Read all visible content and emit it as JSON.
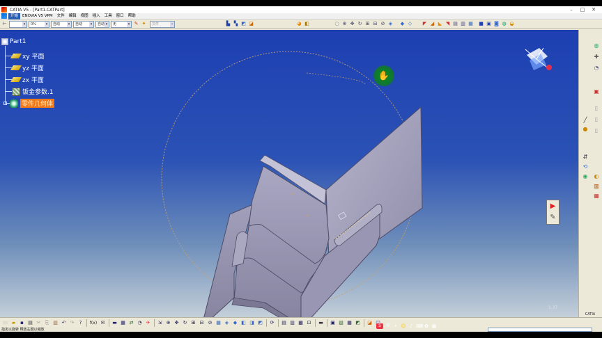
{
  "window": {
    "title": "CATIA V5 - [Part1.CATPart]",
    "buttons": {
      "minimize": "–",
      "maximize": "□",
      "close": "✕"
    }
  },
  "menu": {
    "items": [
      "开始",
      "ENOVIA V5 VPM",
      "文件",
      "编辑",
      "视图",
      "插入",
      "工具",
      "窗口",
      "帮助"
    ],
    "active_index": 0
  },
  "toolbar_top": {
    "combos": [
      "",
      "0%",
      "自动",
      "自动",
      "自动",
      "无"
    ],
    "combo_filter": "文件"
  },
  "tree": {
    "root": "Part1",
    "nodes": [
      {
        "label": "xy 平面",
        "icon": "plane-icon"
      },
      {
        "label": "yz 平面",
        "icon": "plane-icon"
      },
      {
        "label": "zx 平面",
        "icon": "plane-icon"
      },
      {
        "label": "钣金参数.1",
        "icon": "sheetmetal-parameters-icon"
      },
      {
        "label": "零件几何体",
        "icon": "body-icon",
        "highlighted": true
      }
    ]
  },
  "viewport": {
    "scale_label": "1.37",
    "logo": "CATIA",
    "cursor_icon": "hand-pan-icon"
  },
  "status": {
    "text": "指定以旋转 释放左键以缩放",
    "command_value": ""
  },
  "colors": {
    "highlight": "#f07a1a",
    "viewport_top": "#1d3fb2",
    "viewport_bottom": "#c4cfd9",
    "part_face": "#9a98b4"
  }
}
